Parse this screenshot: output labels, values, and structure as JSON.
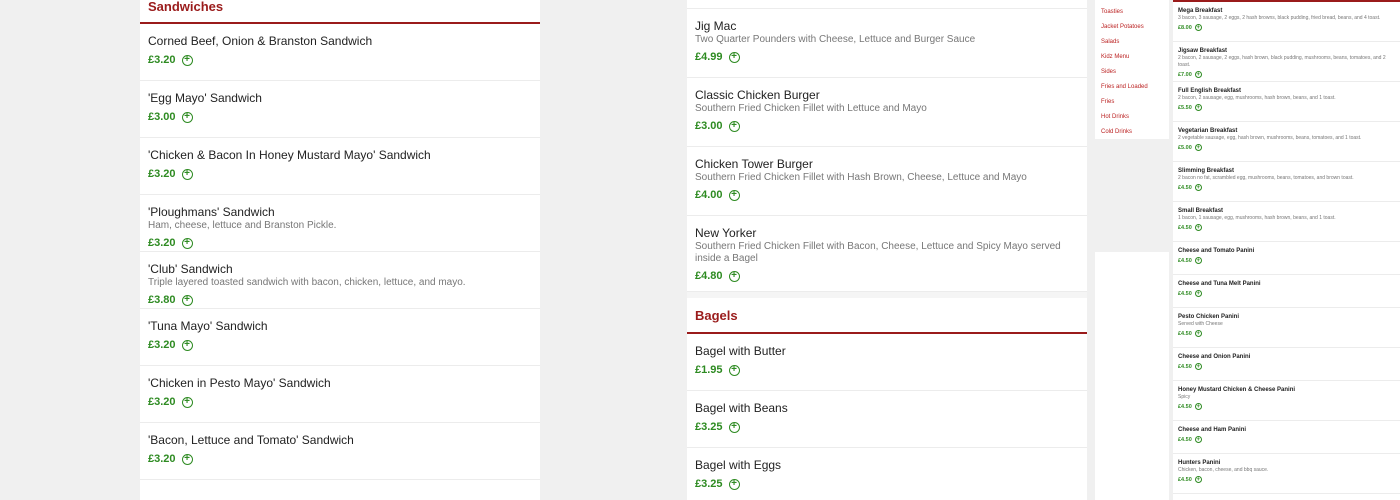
{
  "left": {
    "section_title": "Sandwiches",
    "items": [
      {
        "name": "Corned Beef, Onion & Branston Sandwich",
        "desc": "",
        "price": "£3.20"
      },
      {
        "name": "'Egg Mayo' Sandwich",
        "desc": "",
        "price": "£3.00"
      },
      {
        "name": "'Chicken & Bacon In Honey Mustard Mayo' Sandwich",
        "desc": "",
        "price": "£3.20"
      },
      {
        "name": "'Ploughmans' Sandwich",
        "desc": "Ham, cheese, lettuce and Branston Pickle.",
        "price": "£3.20"
      },
      {
        "name": "'Club' Sandwich",
        "desc": "Triple layered toasted sandwich with bacon, chicken, lettuce, and mayo.",
        "price": "£3.80"
      },
      {
        "name": "'Tuna Mayo' Sandwich",
        "desc": "",
        "price": "£3.20"
      },
      {
        "name": "'Chicken in Pesto Mayo' Sandwich",
        "desc": "",
        "price": "£3.20"
      },
      {
        "name": "'Bacon, Lettuce and Tomato' Sandwich",
        "desc": "",
        "price": "£3.20"
      }
    ]
  },
  "middle": {
    "burgers": [
      {
        "name": "Jig Mac",
        "desc": "Two Quarter Pounders with Cheese, Lettuce and Burger Sauce",
        "price": "£4.99"
      },
      {
        "name": "Classic Chicken Burger",
        "desc": "Southern Fried Chicken Fillet with Lettuce and Mayo",
        "price": "£3.00"
      },
      {
        "name": "Chicken Tower Burger",
        "desc": "Southern Fried Chicken Fillet with Hash Brown, Cheese, Lettuce and Mayo",
        "price": "£4.00"
      },
      {
        "name": "New Yorker",
        "desc": "Southern Fried Chicken Fillet with Bacon, Cheese, Lettuce and Spicy Mayo served inside a Bagel",
        "price": "£4.80"
      }
    ],
    "bagels_title": "Bagels",
    "bagels": [
      {
        "name": "Bagel with Butter",
        "desc": "",
        "price": "£1.95"
      },
      {
        "name": "Bagel with Beans",
        "desc": "",
        "price": "£3.25"
      },
      {
        "name": "Bagel with Eggs",
        "desc": "",
        "price": "£3.25"
      }
    ]
  },
  "categories": [
    "Toasties",
    "Jacket Potatoes",
    "Salads",
    "Kidz Menu",
    "Sides",
    "Fries and Loaded",
    "Fries",
    "Hot Drinks",
    "Cold Drinks"
  ],
  "right": {
    "items": [
      {
        "name": "Mega Breakfast",
        "desc": "3 bacon, 3 sausage, 2 eggs, 2 hash browns, black pudding, fried bread, beans, and 4 toast.",
        "price": "£8.00"
      },
      {
        "name": "Jigsaw Breakfast",
        "desc": "2 bacon, 2 sausage, 2 eggs, hash brown, black pudding, mushrooms, beans, tomatoes, and 2 toast.",
        "price": "£7.00"
      },
      {
        "name": "Full English Breakfast",
        "desc": "2 bacon, 2 sausage, egg, mushrooms, hash brown, beans, and 1 toast.",
        "price": "£5.50"
      },
      {
        "name": "Vegetarian Breakfast",
        "desc": "2 vegetable sausage, egg, hash brown, mushrooms, beans, tomatoes, and 1 toast.",
        "price": "£5.00"
      },
      {
        "name": "Slimming Breakfast",
        "desc": "2 bacon no fat, scrambled egg, mushrooms, beans, tomatoes, and brown toast.",
        "price": "£4.50"
      },
      {
        "name": "Small Breakfast",
        "desc": "1 bacon, 1 sausage, egg, mushrooms, hash brown, beans, and 1 toast.",
        "price": "£4.50"
      },
      {
        "name": "Cheese and Tomato Panini",
        "desc": "",
        "price": "£4.50"
      },
      {
        "name": "Cheese and Tuna Melt Panini",
        "desc": "",
        "price": "£4.50"
      },
      {
        "name": "Pesto Chicken Panini",
        "desc": "Served with Cheese",
        "price": "£4.50"
      },
      {
        "name": "Cheese and Onion Panini",
        "desc": "",
        "price": "£4.50"
      },
      {
        "name": "Honey Mustard Chicken & Cheese Panini",
        "desc": "Spicy",
        "price": "£4.50"
      },
      {
        "name": "Cheese and Ham Panini",
        "desc": "",
        "price": "£4.50"
      },
      {
        "name": "Hunters Panini",
        "desc": "Chicken, bacon, cheese, and bbq sauce.",
        "price": "£4.50"
      }
    ]
  },
  "colors": {
    "accent": "#9a1b1b",
    "price": "#2e8b22",
    "bg": "#f0f0f0"
  }
}
